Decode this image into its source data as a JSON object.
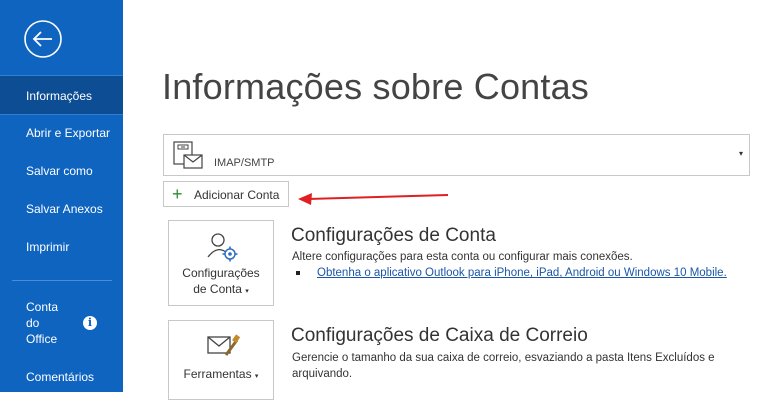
{
  "sidebar": {
    "back_icon": "back-arrow-circle-icon",
    "items": [
      {
        "label": "Informações",
        "active": true
      },
      {
        "label": "Abrir e Exportar"
      },
      {
        "label": "Salvar como"
      },
      {
        "label": "Salvar Anexos"
      },
      {
        "label": "Imprimir"
      },
      {
        "label_lines": [
          "Conta",
          "do",
          "Office"
        ],
        "icon": "info-icon"
      },
      {
        "label": "Comentários"
      }
    ],
    "info_glyph": "i"
  },
  "main": {
    "title": "Informações sobre Contas",
    "account_selector": {
      "value": "IMAP/SMTP",
      "icon": "mailbox-account-icon",
      "caret": "▾"
    },
    "add_account": {
      "label": "Adicionar Conta",
      "icon": "plus-icon",
      "plus_glyph": "+"
    },
    "sections": [
      {
        "button_lines": [
          "Configurações",
          "de Conta"
        ],
        "button_caret": "▾",
        "button_icon": "account-settings-icon",
        "title": "Configurações de Conta",
        "description": "Altere configurações para esta conta ou configurar mais conexões.",
        "link": "Obtenha o aplicativo Outlook para iPhone, iPad, Android ou Windows 10 Mobile."
      },
      {
        "button_lines": [
          "Ferramentas"
        ],
        "button_caret": "▾",
        "button_icon": "mailbox-tools-icon",
        "title": "Configurações de Caixa de Correio",
        "description_lines": [
          "Gerencie o tamanho da sua caixa de correio, esvaziando a pasta Itens Excluídos e",
          "arquivando."
        ]
      }
    ]
  },
  "colors": {
    "sidebar": "#0f64c0",
    "sidebar_active": "#0c4d94",
    "annotation_arrow": "#e02020",
    "link": "#1a56a8"
  }
}
